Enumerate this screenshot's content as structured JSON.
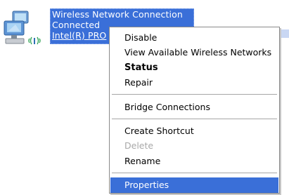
{
  "connection": {
    "name": "Wireless Network Connection",
    "status": "Connected",
    "adapter": "Intel(R) PRO",
    "icon": "wireless-network-connection-icon"
  },
  "context_menu": {
    "items": [
      {
        "label": "Disable",
        "state": "normal"
      },
      {
        "label": "View Available Wireless Networks",
        "state": "normal"
      },
      {
        "label": "Status",
        "state": "default"
      },
      {
        "label": "Repair",
        "state": "normal"
      },
      {
        "label": "Bridge Connections",
        "state": "normal"
      },
      {
        "label": "Create Shortcut",
        "state": "normal"
      },
      {
        "label": "Delete",
        "state": "disabled"
      },
      {
        "label": "Rename",
        "state": "normal"
      },
      {
        "label": "Properties",
        "state": "selected"
      }
    ]
  },
  "colors": {
    "selection": "#3a6fd8",
    "disabled_text": "#a8a8a8",
    "menu_border": "#8a8a8a"
  }
}
